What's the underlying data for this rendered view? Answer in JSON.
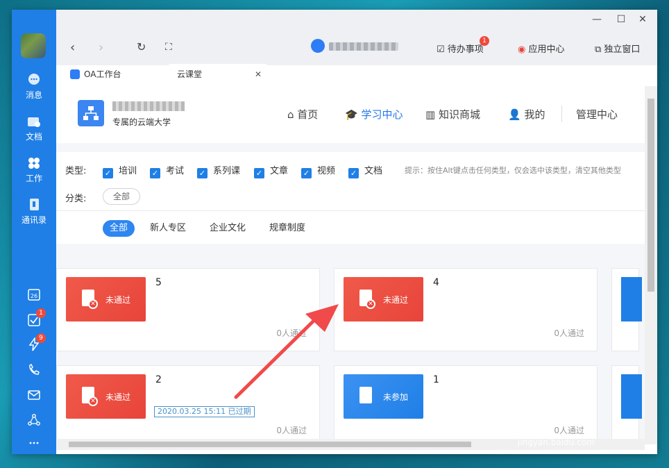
{
  "rail": {
    "items": [
      {
        "label": "消息"
      },
      {
        "label": "文档"
      },
      {
        "label": "工作"
      },
      {
        "label": "通讯录"
      }
    ],
    "calendar_day": "26",
    "todo_badge": "1",
    "flash_badge": "9"
  },
  "topbar": {
    "todo_label": "待办事项",
    "todo_badge": "1",
    "appcenter_label": "应用中心",
    "standalone_label": "独立窗口"
  },
  "tabs": [
    {
      "label": "OA工作台"
    },
    {
      "label": "云课堂"
    }
  ],
  "header": {
    "subtitle": "专属的云端大学",
    "nav": [
      {
        "label": "首页"
      },
      {
        "label": "学习中心"
      },
      {
        "label": "知识商城"
      },
      {
        "label": "我的"
      },
      {
        "label": "管理中心"
      }
    ]
  },
  "filters": {
    "type_label": "类型:",
    "types": [
      "培训",
      "考试",
      "系列课",
      "文章",
      "视频",
      "文档"
    ],
    "hint": "提示：按住Alt键点击任何类型，仅会选中该类型，清空其他类型",
    "category_label": "分类:",
    "category_all": "全部",
    "subtabs": [
      "全部",
      "新人专区",
      "企业文化",
      "规章制度"
    ]
  },
  "cards": [
    {
      "num": "5",
      "status": "未通过",
      "count": "0人通过"
    },
    {
      "num": "4",
      "status": "未通过",
      "count": "0人通过"
    },
    {
      "num": "2",
      "status": "未通过",
      "count": "0人通过",
      "expired": "2020.03.25 15:11 已过期"
    },
    {
      "num": "1",
      "status": "未参加",
      "count": "0人通过"
    }
  ],
  "colors": {
    "accent": "#1f7fe6",
    "fail": "#e8443a"
  }
}
